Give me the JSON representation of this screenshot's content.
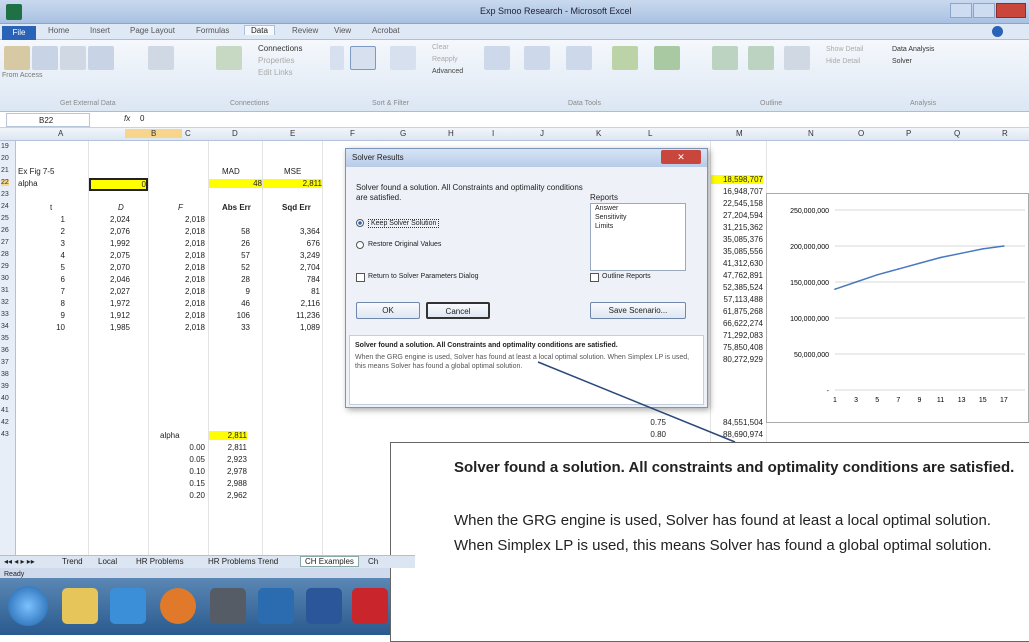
{
  "window": {
    "title": "Exp Smoo Research - Microsoft Excel"
  },
  "ribbon": {
    "file_label": "File",
    "tabs": [
      "Home",
      "Insert",
      "Page Layout",
      "Formulas",
      "Data",
      "Review",
      "View",
      "Acrobat"
    ],
    "data_group_labels": [
      "Get External Data",
      "Connections",
      "Sort & Filter",
      "Data Tools",
      "Outline",
      "Analysis"
    ],
    "buttons": [
      "From Access",
      "From Web",
      "From Text",
      "From Other Sources",
      "Existing Connections",
      "Refresh All",
      "Connections",
      "Properties",
      "Edit Links",
      "Sort",
      "Filter",
      "Clear",
      "Reapply",
      "Advanced",
      "Text to Columns",
      "Remove Duplicates",
      "Data Validation",
      "Consolidate",
      "What-If Analysis",
      "Group",
      "Ungroup",
      "Subtotal",
      "Show Detail",
      "Hide Detail",
      "Data Analysis",
      "Solver"
    ]
  },
  "formula": {
    "cell_ref": "B22",
    "fx": "fx",
    "value": "0"
  },
  "columns": [
    "A",
    "B",
    "C",
    "D",
    "E",
    "F",
    "G",
    "H",
    "I",
    "J",
    "K",
    "L",
    "M",
    "N",
    "O",
    "P",
    "Q",
    "R"
  ],
  "rows": [
    "19",
    "20",
    "21",
    "22",
    "23",
    "24",
    "25",
    "26",
    "27",
    "28",
    "29",
    "30",
    "31",
    "32",
    "33",
    "34",
    "35",
    "36",
    "37",
    "38",
    "39",
    "40",
    "41",
    "42",
    "43"
  ],
  "sheet": {
    "r21": {
      "a": "Ex Fig 7-5",
      "d": "MAD",
      "e": "MSE"
    },
    "r22": {
      "a": "alpha",
      "b": "0",
      "d": "48",
      "e": "2,811"
    },
    "header": {
      "a": "t",
      "b": "D",
      "c": "F",
      "d": "Abs Err",
      "e": "Sqd Err"
    },
    "data": [
      {
        "t": "1",
        "d": "2,024",
        "f": "2,018",
        "abs": "",
        "sq": ""
      },
      {
        "t": "2",
        "d": "2,076",
        "f": "2,018",
        "abs": "58",
        "sq": "3,364"
      },
      {
        "t": "3",
        "d": "1,992",
        "f": "2,018",
        "abs": "26",
        "sq": "676"
      },
      {
        "t": "4",
        "d": "2,075",
        "f": "2,018",
        "abs": "57",
        "sq": "3,249"
      },
      {
        "t": "5",
        "d": "2,070",
        "f": "2,018",
        "abs": "52",
        "sq": "2,704"
      },
      {
        "t": "6",
        "d": "2,046",
        "f": "2,018",
        "abs": "28",
        "sq": "784"
      },
      {
        "t": "7",
        "d": "2,027",
        "f": "2,018",
        "abs": "9",
        "sq": "81"
      },
      {
        "t": "8",
        "d": "1,972",
        "f": "2,018",
        "abs": "46",
        "sq": "2,116"
      },
      {
        "t": "9",
        "d": "1,912",
        "f": "2,018",
        "abs": "106",
        "sq": "11,236"
      },
      {
        "t": "10",
        "d": "1,985",
        "f": "2,018",
        "abs": "33",
        "sq": "1,089"
      }
    ],
    "alpha_label": "alpha",
    "alpha_table": [
      {
        "a": "",
        "v": "2,811"
      },
      {
        "a": "0.00",
        "v": "2,811"
      },
      {
        "a": "0.05",
        "v": "2,923"
      },
      {
        "a": "0.10",
        "v": "2,978"
      },
      {
        "a": "0.15",
        "v": "2,988"
      },
      {
        "a": "0.20",
        "v": "2,962"
      }
    ],
    "col_m": [
      "18,598,707",
      "16,948,707",
      "22,545,158",
      "27,204,594",
      "31,215,362",
      "35,085,376",
      "35,085,556",
      "41,312,630",
      "47,762,891",
      "52,385,524",
      "57,113,488",
      "61,875,268",
      "66,622,274",
      "71,292,083",
      "75,850,408",
      "80,272,929",
      "84,551,504",
      "88,690,974"
    ],
    "col_l": [
      "0.75",
      "0.80"
    ]
  },
  "dialog": {
    "title": "Solver Results",
    "message": "Solver found a solution.  All Constraints and optimality conditions are satisfied.",
    "keep_label": "Keep Solver Solution",
    "restore_label": "Restore Original Values",
    "reports_label": "Reports",
    "reports": [
      "Answer",
      "Sensitivity",
      "Limits"
    ],
    "return_label": "Return to Solver Parameters Dialog",
    "outline_label": "Outline Reports",
    "ok": "OK",
    "cancel": "Cancel",
    "save": "Save Scenario...",
    "panel_bold": "Solver found a solution.  All Constraints and optimality conditions are satisfied.",
    "panel_text": "When the GRG engine is used, Solver has found at least a local optimal solution. When Simplex LP is used, this means Solver has found a global optimal solution."
  },
  "callout": {
    "bold": "Solver found a solution.  All constraints and optimality conditions are satisfied.",
    "text": "When the GRG engine is used, Solver has found at least a local optimal solution.  When Simplex LP is used, this means Solver has found a global optimal solution."
  },
  "sheet_tabs": [
    "Trend",
    "Local",
    "HR Problems",
    "HR Problems Trend",
    "CH Examples",
    "Ch"
  ],
  "status": "Ready",
  "chart_data": {
    "type": "line",
    "x": [
      1,
      3,
      5,
      7,
      9,
      11,
      13,
      15,
      17
    ],
    "y_ticks": [
      "250,000,000",
      "200,000,000",
      "150,000,000",
      "100,000,000",
      "50,000,000",
      "-"
    ],
    "x_ticks": [
      "1",
      "3",
      "5",
      "7",
      "9",
      "11",
      "13",
      "15",
      "17"
    ],
    "ylim": [
      0,
      250000000
    ],
    "series": [
      {
        "values": [
          140000000,
          150000000,
          160000000,
          168000000,
          176000000,
          184000000,
          190000000,
          196000000,
          200000000
        ]
      }
    ],
    "color": "#4a78c0"
  }
}
